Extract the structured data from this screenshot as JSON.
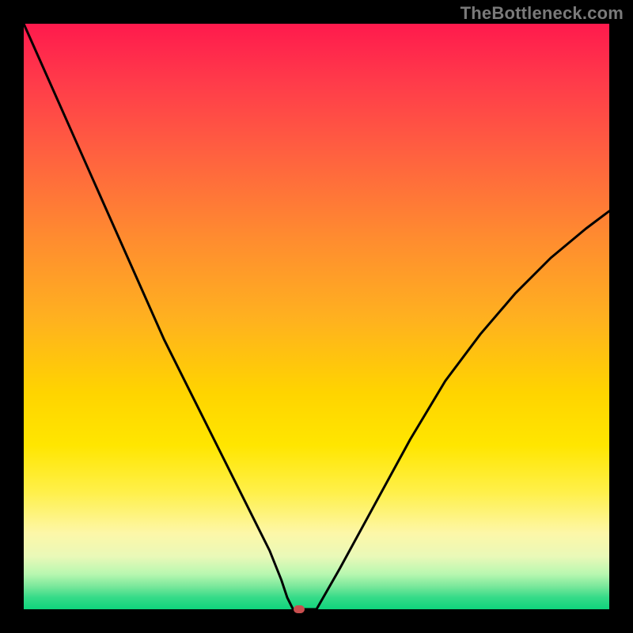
{
  "watermark": "TheBottleneck.com",
  "colors": {
    "frame": "#000000",
    "curve": "#000000",
    "marker": "#c94f4f"
  },
  "chart_data": {
    "type": "line",
    "title": "",
    "xlabel": "",
    "ylabel": "",
    "xlim": [
      0,
      100
    ],
    "ylim": [
      0,
      100
    ],
    "grid": false,
    "series": [
      {
        "name": "bottleneck-curve",
        "x": [
          0,
          4,
          8,
          12,
          16,
          20,
          24,
          28,
          32,
          36,
          40,
          42,
          44,
          45,
          46,
          48,
          50,
          54,
          60,
          66,
          72,
          78,
          84,
          90,
          96,
          100
        ],
        "y": [
          100,
          91,
          82,
          73,
          64,
          55,
          46,
          38,
          30,
          22,
          14,
          10,
          5,
          2,
          0,
          0,
          0,
          7,
          18,
          29,
          39,
          47,
          54,
          60,
          65,
          68
        ]
      }
    ],
    "annotations": [
      {
        "name": "min-marker",
        "x": 47,
        "y": 0
      }
    ],
    "gradient_stops": [
      {
        "pos": 0.0,
        "color": "#ff1a4d"
      },
      {
        "pos": 0.5,
        "color": "#ffd400"
      },
      {
        "pos": 0.9,
        "color": "#fdf7a8"
      },
      {
        "pos": 1.0,
        "color": "#0fd47c"
      }
    ]
  }
}
